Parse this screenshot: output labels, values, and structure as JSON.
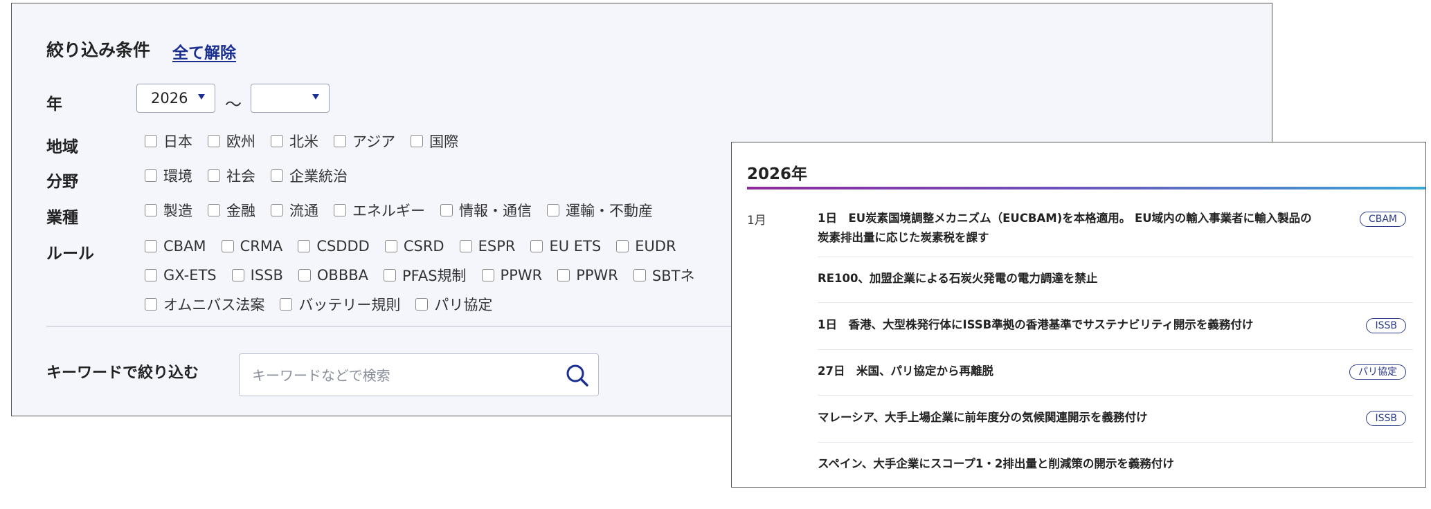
{
  "filter": {
    "title": "絞り込み条件",
    "clear_all": "全て解除",
    "year": {
      "label": "年",
      "from": "2026",
      "to": "",
      "separator": "〜"
    },
    "region": {
      "label": "地域",
      "options": [
        "日本",
        "欧州",
        "北米",
        "アジア",
        "国際"
      ]
    },
    "field": {
      "label": "分野",
      "options": [
        "環境",
        "社会",
        "企業統治"
      ]
    },
    "industry": {
      "label": "業種",
      "options": [
        "製造",
        "金融",
        "流通",
        "エネルギー",
        "情報・通信",
        "運輸・不動産"
      ]
    },
    "rule": {
      "label": "ルール",
      "row1": [
        "CBAM",
        "CRMA",
        "CSDDD",
        "CSRD",
        "ESPR",
        "EU ETS",
        "EUDR"
      ],
      "row2": [
        "GX-ETS",
        "ISSB",
        "OBBBA",
        "PFAS規制",
        "PPWR",
        "PPWR",
        "SBTネ"
      ],
      "row3": [
        "オムニバス法案",
        "バッテリー規則",
        "パリ協定"
      ]
    },
    "keyword": {
      "label": "キーワードで絞り込む",
      "placeholder": "キーワードなどで検索"
    }
  },
  "timeline": {
    "year": "2026年",
    "month": "1月",
    "items": [
      {
        "line1": "1日　EU炭素国境調整メカニズム（EUCBAM)を本格適用。 EU域内の輸入事業者に輸入製品の",
        "line2": "炭素排出量に応じた炭素税を課す",
        "badge": "CBAM"
      },
      {
        "line1": "RE100、加盟企業による石炭火発電の電力調達を禁止",
        "badge": ""
      },
      {
        "line1": "1日　香港、大型株発行体にISSB準拠の香港基準でサステナビリティ開示を義務付け",
        "badge": "ISSB"
      },
      {
        "line1": "27日　米国、パリ協定から再離脱",
        "badge": "パリ協定"
      },
      {
        "line1": "マレーシア、大手上場企業に前年度分の気候関連開示を義務付け",
        "badge": "ISSB"
      },
      {
        "line1": "スペイン、大手企業にスコープ1・2排出量と削減策の開示を義務付け",
        "badge": ""
      }
    ]
  }
}
